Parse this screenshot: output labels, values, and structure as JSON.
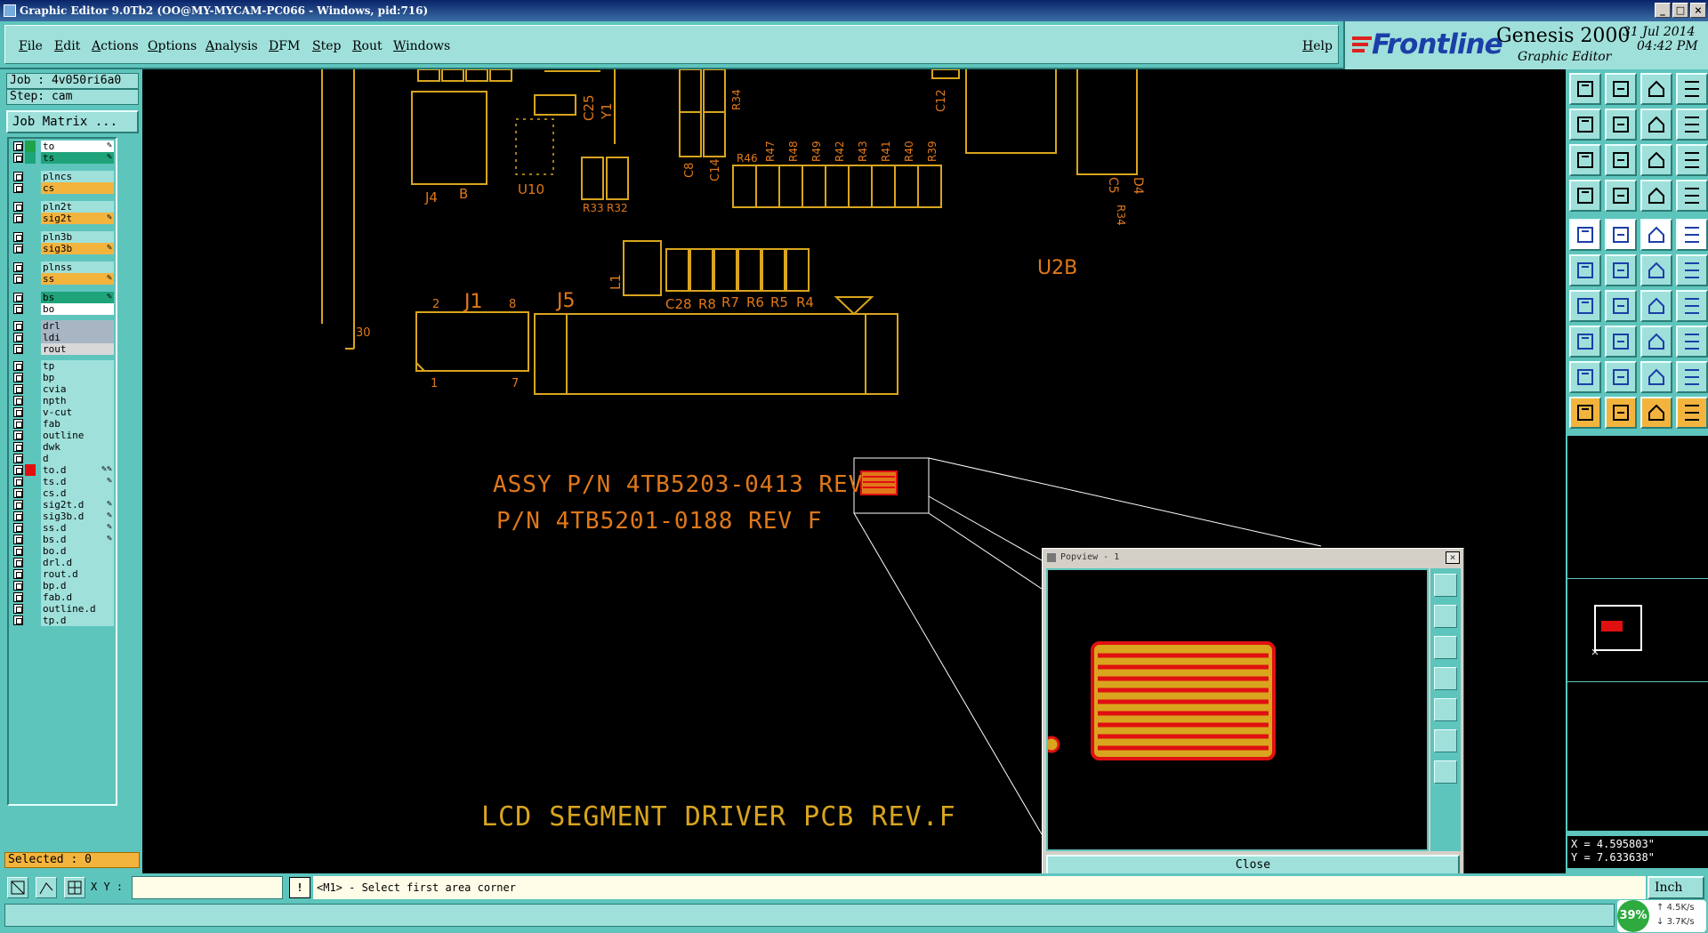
{
  "window": {
    "title": "Graphic Editor 9.0Tb2 (OO@MY-MYCAM-PC066 - Windows, pid:716)",
    "controls": [
      "_",
      "□",
      "×"
    ]
  },
  "menu": {
    "items": [
      "File",
      "Edit",
      "Actions",
      "Options",
      "Analysis",
      "DFM",
      "Step",
      "Rout",
      "Windows"
    ],
    "help": "Help"
  },
  "brand": {
    "logo": "Frontline",
    "product": "Genesis 2000",
    "subtitle": "Graphic Editor",
    "date": "31 Jul 2014",
    "time": "04:42 PM"
  },
  "job": {
    "job_label": "Job : 4v050ri6a0",
    "step_label": "Step: cam",
    "matrix_button": "Job Matrix ..."
  },
  "layers": [
    {
      "name": "to",
      "color": "#ffffff",
      "swatch": "#1fa34a",
      "edit": "✎"
    },
    {
      "name": "ts",
      "color": "#1fa37a",
      "swatch": "#1fa37a",
      "edit": "✎"
    },
    {
      "name": "plncs",
      "color": "#9fe0da",
      "swatch": "",
      "edit": ""
    },
    {
      "name": "cs",
      "color": "#f3b43e",
      "swatch": "",
      "edit": ""
    },
    {
      "name": "pln2t",
      "color": "#9fe0da",
      "swatch": "",
      "edit": ""
    },
    {
      "name": "sig2t",
      "color": "#f3b43e",
      "swatch": "",
      "edit": "✎"
    },
    {
      "name": "pln3b",
      "color": "#9fe0da",
      "swatch": "",
      "edit": ""
    },
    {
      "name": "sig3b",
      "color": "#f3b43e",
      "swatch": "",
      "edit": "✎"
    },
    {
      "name": "plnss",
      "color": "#9fe0da",
      "swatch": "",
      "edit": ""
    },
    {
      "name": "ss",
      "color": "#f3b43e",
      "swatch": "",
      "edit": "✎"
    },
    {
      "name": "bs",
      "color": "#1fa37a",
      "swatch": "",
      "edit": "✎"
    },
    {
      "name": "bo",
      "color": "#ffffff",
      "swatch": "",
      "edit": ""
    },
    {
      "name": "drl",
      "color": "#a8b6c4",
      "swatch": "",
      "edit": ""
    },
    {
      "name": "ldi",
      "color": "#a8b6c4",
      "swatch": "",
      "edit": ""
    },
    {
      "name": "rout",
      "color": "#d8d8d8",
      "swatch": "",
      "edit": ""
    },
    {
      "name": "tp",
      "color": "#9fe0da",
      "swatch": "",
      "edit": ""
    },
    {
      "name": "bp",
      "color": "#9fe0da",
      "swatch": "",
      "edit": ""
    },
    {
      "name": "cvia",
      "color": "#9fe0da",
      "swatch": "",
      "edit": ""
    },
    {
      "name": "npth",
      "color": "#9fe0da",
      "swatch": "",
      "edit": ""
    },
    {
      "name": "v-cut",
      "color": "#9fe0da",
      "swatch": "",
      "edit": ""
    },
    {
      "name": "fab",
      "color": "#9fe0da",
      "swatch": "",
      "edit": ""
    },
    {
      "name": "outline",
      "color": "#9fe0da",
      "swatch": "",
      "edit": ""
    },
    {
      "name": "dwk",
      "color": "#9fe0da",
      "swatch": "",
      "edit": ""
    },
    {
      "name": "d",
      "color": "#9fe0da",
      "swatch": "",
      "edit": ""
    },
    {
      "name": "to.d",
      "color": "#9fe0da",
      "swatch": "#e01010",
      "edit": "✎✎"
    },
    {
      "name": "ts.d",
      "color": "#9fe0da",
      "swatch": "",
      "edit": "✎"
    },
    {
      "name": "cs.d",
      "color": "#9fe0da",
      "swatch": "",
      "edit": ""
    },
    {
      "name": "sig2t.d",
      "color": "#9fe0da",
      "swatch": "",
      "edit": "✎"
    },
    {
      "name": "sig3b.d",
      "color": "#9fe0da",
      "swatch": "",
      "edit": "✎"
    },
    {
      "name": "ss.d",
      "color": "#9fe0da",
      "swatch": "",
      "edit": "✎"
    },
    {
      "name": "bs.d",
      "color": "#9fe0da",
      "swatch": "",
      "edit": "✎"
    },
    {
      "name": "bo.d",
      "color": "#9fe0da",
      "swatch": "",
      "edit": ""
    },
    {
      "name": "drl.d",
      "color": "#9fe0da",
      "swatch": "",
      "edit": ""
    },
    {
      "name": "rout.d",
      "color": "#9fe0da",
      "swatch": "",
      "edit": ""
    },
    {
      "name": "bp.d",
      "color": "#9fe0da",
      "swatch": "",
      "edit": ""
    },
    {
      "name": "fab.d",
      "color": "#9fe0da",
      "swatch": "",
      "edit": ""
    },
    {
      "name": "outline.d",
      "color": "#9fe0da",
      "swatch": "",
      "edit": ""
    },
    {
      "name": "tp.d",
      "color": "#9fe0da",
      "swatch": "",
      "edit": ""
    }
  ],
  "selected": "Selected : 0",
  "board": {
    "refdes": [
      "J4",
      "B",
      "U10",
      "C25",
      "Y1",
      "C8",
      "C14",
      "R34",
      "C12",
      "R46",
      "R47",
      "R48",
      "R49",
      "R42",
      "R43",
      "R41",
      "R40",
      "R39",
      "R34",
      "C5",
      "D4",
      "U2B",
      "R33",
      "R32",
      "L1",
      "C28",
      "R8",
      "R7",
      "R6",
      "R5",
      "R4",
      "J1",
      "2",
      "8",
      "1",
      "7",
      "J5",
      "30"
    ],
    "assy_text": "ASSY P/N 4TB5203-0413 REV",
    "pn_text": "P/N 4TB5201-0188 REV F",
    "title_text": "LCD SEGMENT DRIVER PCB REV.F"
  },
  "popview": {
    "title": "Popview - 1",
    "close_button": "Close"
  },
  "coords": {
    "x": "X = 4.595803\"",
    "y": "Y = 7.633638\""
  },
  "bottom": {
    "xy_label": "X Y :",
    "xy_value": "",
    "msg_icon": "!",
    "message": "<M1> - Select first area corner",
    "units": "Inch"
  },
  "network": {
    "percent": "39%",
    "up": "4.5K/s",
    "down": "3.7K/s"
  },
  "colors": {
    "panel": "#5ec5bd",
    "panel_light": "#9fe0da",
    "trace": "#d9a51e",
    "silk": "#e0781a",
    "highlight": "#e01010"
  }
}
